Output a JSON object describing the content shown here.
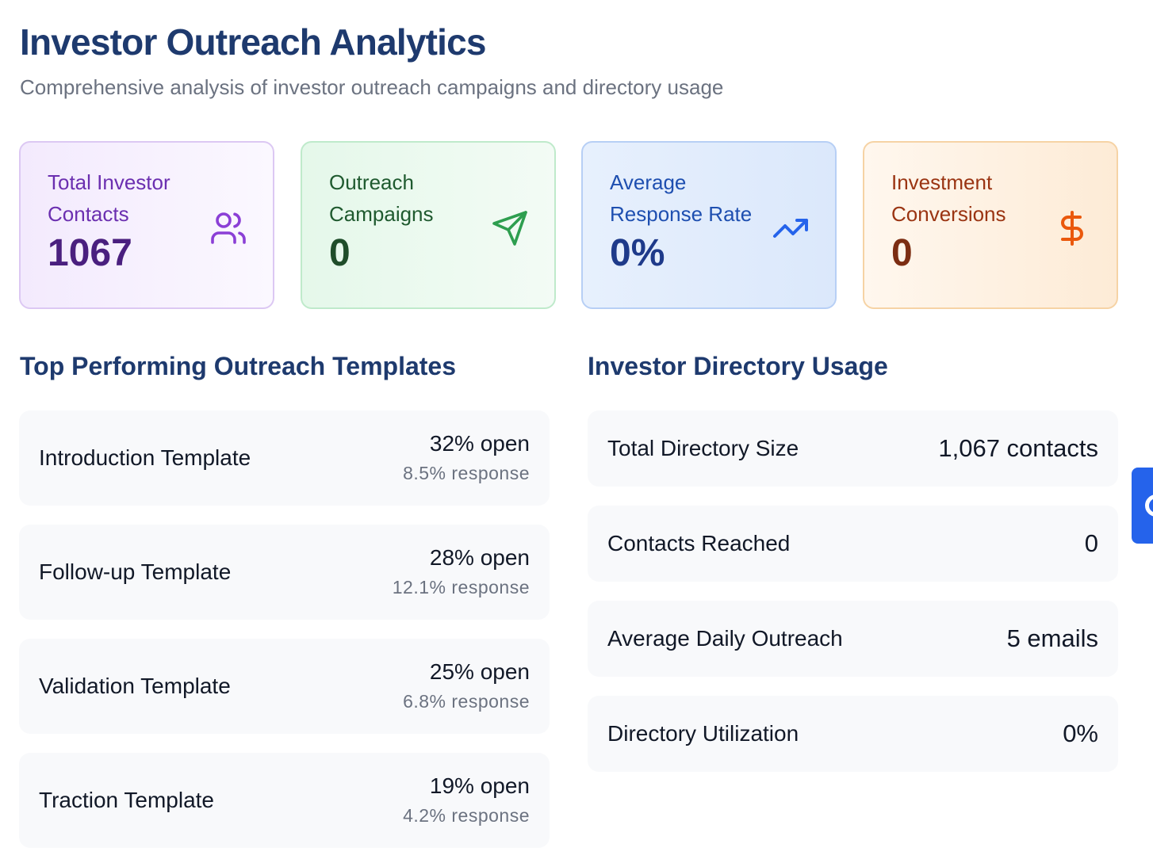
{
  "header": {
    "title": "Investor Outreach Analytics",
    "subtitle": "Comprehensive analysis of investor outreach campaigns and directory usage"
  },
  "stats": [
    {
      "label": "Total Investor Contacts",
      "value": "1067",
      "icon": "users-icon",
      "color": "#6b2fb0"
    },
    {
      "label": "Outreach Campaigns",
      "value": "0",
      "icon": "send-icon",
      "color": "#2e9e4f"
    },
    {
      "label": "Average Response Rate",
      "value": "0%",
      "icon": "trending-up-icon",
      "color": "#2563eb"
    },
    {
      "label": "Investment Conversions",
      "value": "0",
      "icon": "dollar-icon",
      "color": "#ea580c"
    }
  ],
  "templates": {
    "title": "Top Performing Outreach Templates",
    "items": [
      {
        "name": "Introduction Template",
        "open": "32% open",
        "response": "8.5% response"
      },
      {
        "name": "Follow-up Template",
        "open": "28% open",
        "response": "12.1% response"
      },
      {
        "name": "Validation Template",
        "open": "25% open",
        "response": "6.8% response"
      },
      {
        "name": "Traction Template",
        "open": "19% open",
        "response": "4.2% response"
      }
    ]
  },
  "directory": {
    "title": "Investor Directory Usage",
    "items": [
      {
        "label": "Total Directory Size",
        "value": "1,067 contacts"
      },
      {
        "label": "Contacts Reached",
        "value": "0"
      },
      {
        "label": "Average Daily Outreach",
        "value": "5 emails"
      },
      {
        "label": "Directory Utilization",
        "value": "0%"
      }
    ]
  },
  "side_tab": {
    "icon": "feedback-icon",
    "color": "#2563eb"
  }
}
